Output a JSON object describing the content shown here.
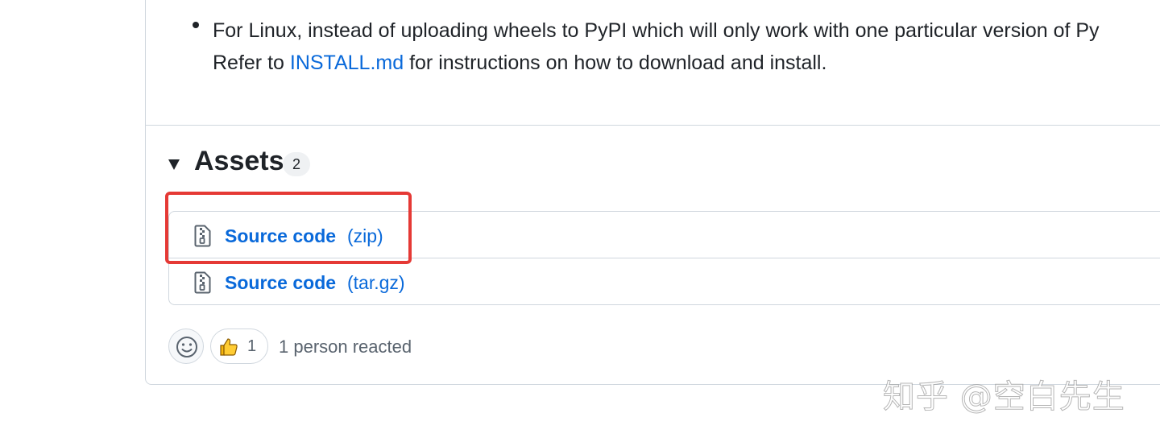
{
  "release_notes": {
    "bullet_text_1": "For Linux, instead of uploading wheels to PyPI which will only work with one particular version of Py",
    "line2_prefix": "Refer to ",
    "install_link": "INSTALL.md",
    "line2_suffix": " for instructions on how to download and install."
  },
  "assets": {
    "title": "Assets",
    "count": "2",
    "items": [
      {
        "name": "Source code",
        "ext": "(zip)",
        "icon": "file-zip-icon"
      },
      {
        "name": "Source code",
        "ext": "(tar.gz)",
        "icon": "file-zip-icon"
      }
    ]
  },
  "reactions": {
    "add_reaction_icon": "smiley-icon",
    "thumbs_icon": "thumbs-up-icon",
    "thumbs_count": "1",
    "summary": "1 person reacted"
  },
  "watermark": "知乎 @空白先生",
  "colors": {
    "link": "#0969da",
    "border": "#d0d7de",
    "highlight": "#e53935"
  }
}
